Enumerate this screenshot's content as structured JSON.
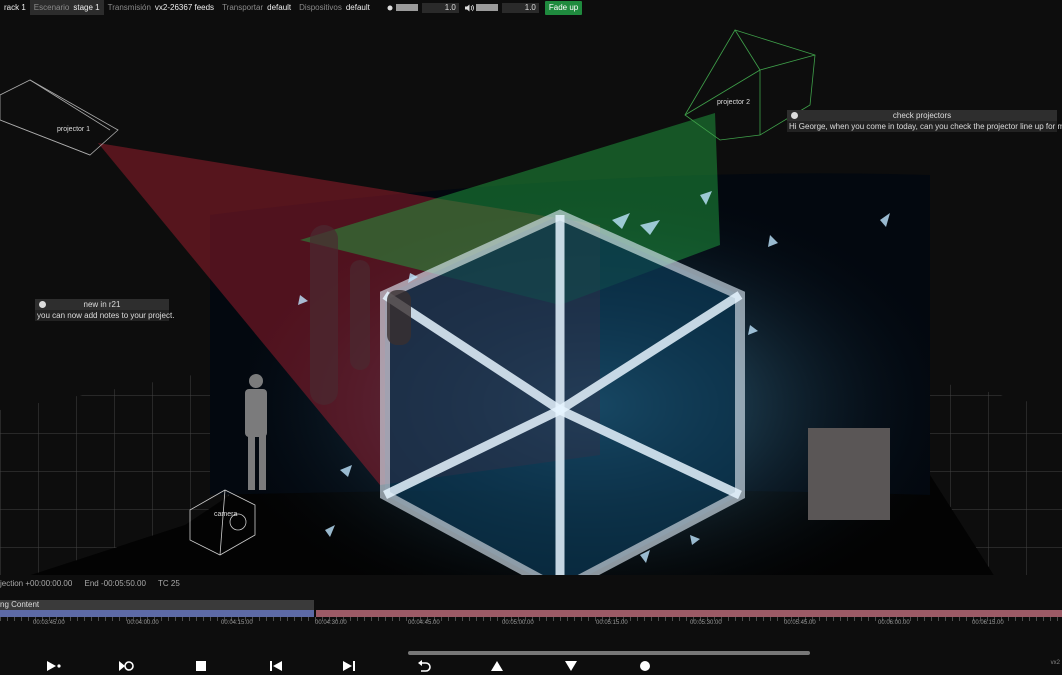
{
  "topbar": {
    "track": "rack 1",
    "stage_label": "Escenario",
    "stage_value": "stage 1",
    "trans_label": "Transmisión",
    "trans_value": "vx2-26367 feeds",
    "transport_label": "Transportar",
    "transport_value": "default",
    "devices_label": "Dispositivos",
    "devices_value": "default",
    "brightness_value": "1.0",
    "volume_value": "1.0",
    "fade_label": "Fade up"
  },
  "projectors": {
    "p1": "projector 1",
    "p2": "projector 2",
    "camera": "camera"
  },
  "notes": [
    {
      "title": "check projectors",
      "body": "Hi George, when you come in today, can you check the projector line up for me."
    },
    {
      "title": "new in r21",
      "body": "you can now add notes to your project."
    }
  ],
  "info": {
    "projection": "jection +00:00:00.00",
    "end": "End -00:05:50.00",
    "tc": "TC 25"
  },
  "timeline": {
    "layer_label": "ng Content",
    "timecodes": [
      "00:03:45.00",
      "00:04:00.00",
      "00:04:15.00",
      "00:04:30.00",
      "00:04:45.00",
      "00:05:00.00",
      "00:05:15.00",
      "00:05:30.00",
      "00:05:45.00",
      "00:06:00.00",
      "00:06:15.00"
    ]
  },
  "footer": {
    "version": "vx2"
  },
  "colors": {
    "accent_green": "#1f8a3e",
    "projector1": "#c0303a",
    "projector2": "#2fb040",
    "clip_blue": "#5d6aa6",
    "clip_red": "#9c5a66"
  }
}
